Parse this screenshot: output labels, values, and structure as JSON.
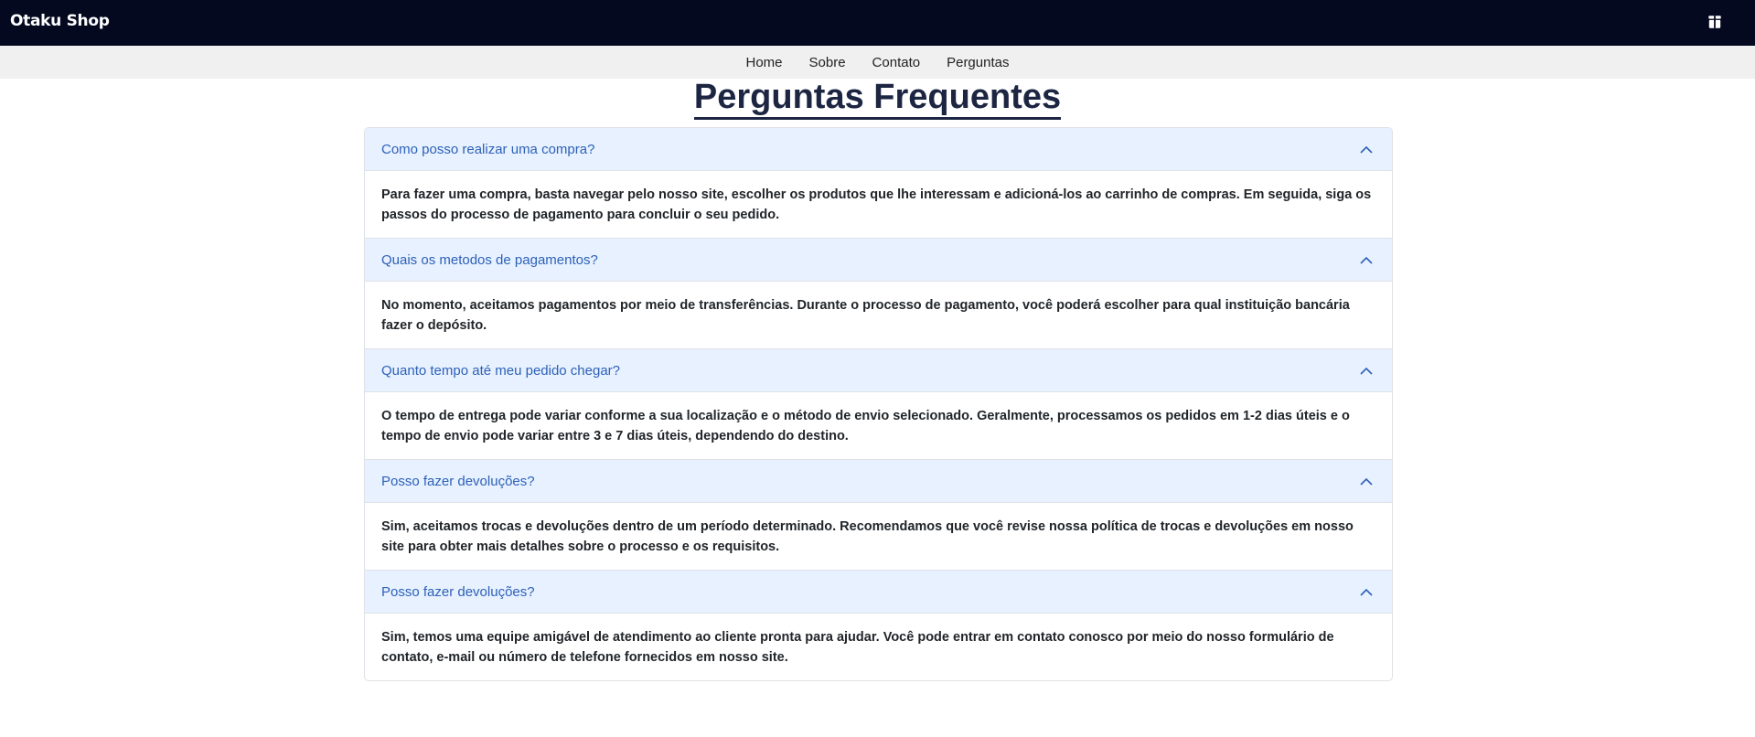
{
  "header": {
    "brand": "Otaku Shop",
    "cart_icon": "cart-icon"
  },
  "nav": {
    "items": [
      {
        "label": "Home"
      },
      {
        "label": "Sobre"
      },
      {
        "label": "Contato"
      },
      {
        "label": "Perguntas"
      }
    ]
  },
  "page": {
    "title": "Perguntas Frequentes"
  },
  "faq": [
    {
      "question": "Como posso realizar uma compra?",
      "answer": "Para fazer uma compra, basta navegar pelo nosso site, escolher os produtos que lhe interessam e adicioná-los ao carrinho de compras. Em seguida, siga os passos do processo de pagamento para concluir o seu pedido."
    },
    {
      "question": "Quais os metodos de pagamentos?",
      "answer": "No momento, aceitamos pagamentos por meio de transferências. Durante o processo de pagamento, você poderá escolher para qual instituição bancária fazer o depósito."
    },
    {
      "question": "Quanto tempo até meu pedido chegar?",
      "answer": "O tempo de entrega pode variar conforme a sua localização e o método de envio selecionado. Geralmente, processamos os pedidos em 1-2 dias úteis e o tempo de envio pode variar entre 3 e 7 dias úteis, dependendo do destino."
    },
    {
      "question": "Posso fazer devoluções?",
      "answer": "Sim, aceitamos trocas e devoluções dentro de um período determinado. Recomendamos que você revise nossa política de trocas e devoluções em nosso site para obter mais detalhes sobre o processo e os requisitos."
    },
    {
      "question": "Posso fazer devoluções?",
      "answer": "Sim, temos uma equipe amigável de atendimento ao cliente pronta para ajudar. Você pode entrar em contato conosco por meio do nosso formulário de contato, e-mail ou número de telefone fornecidos em nosso site."
    }
  ],
  "colors": {
    "topbar": "#050920",
    "navbar": "#f0f0f0",
    "accordion_header": "#e7f1ff",
    "question_text": "#2e61b8",
    "title": "#1c2541"
  }
}
